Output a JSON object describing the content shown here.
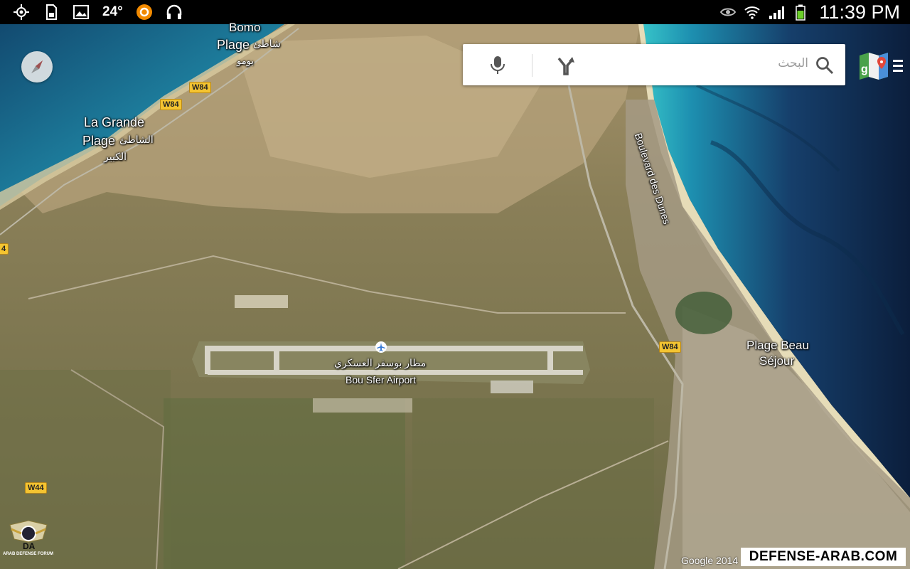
{
  "status_bar": {
    "temperature": "24°",
    "time": "11:39 PM",
    "icons": [
      "gps-icon",
      "sd-card-icon",
      "gallery-icon",
      "weather-temp",
      "sync-app-icon",
      "headphones-icon",
      "eye-icon",
      "wifi-icon",
      "signal-icon",
      "battery-icon"
    ]
  },
  "search": {
    "placeholder": "البحث"
  },
  "map_labels": {
    "bomo_plage_1": "Bomo",
    "bomo_plage_2": "Plage",
    "bomo_ar_1": "شاطئ",
    "bomo_ar_2": "بومو",
    "grande_1": "La Grande",
    "grande_2": "Plage",
    "grande_ar_1": "الشاطئ",
    "grande_ar_2": "الكبير",
    "boulevard": "Boulevard des Dunes",
    "plage_beau_1": "Plage Beau",
    "plage_beau_2": "Séjour",
    "airport_ar": "مطار بوسفر العسكري",
    "airport_en": "Bou Sfer Airport"
  },
  "road_shields": {
    "w84_a": "W84",
    "w84_b": "W84",
    "w84_c": "W84",
    "w44": "W44",
    "edge": "4"
  },
  "credit": "Google 2014",
  "watermark": "DEFENSE-ARAB.COM",
  "forum_logo_text": "ARAB DEFENSE FORUM",
  "colors": {
    "sea_deep": "#0f2a4a",
    "sea_shallow": "#2aa7b5",
    "land": "#7d7650",
    "sand": "#c7b98d",
    "road_shield": "#f4c431"
  }
}
